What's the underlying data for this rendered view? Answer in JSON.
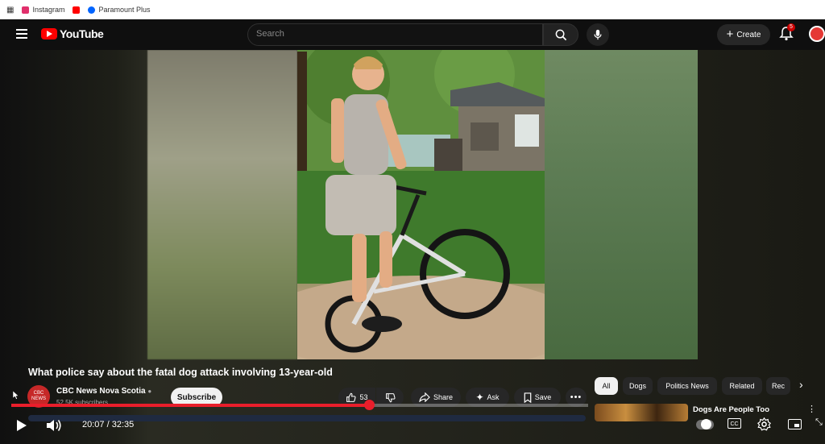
{
  "bookmarks": [
    {
      "label": "Instagram",
      "color": "#e1306c"
    },
    {
      "label": "",
      "color": "#ff0000"
    },
    {
      "label": "Paramount Plus",
      "color": "#0064ff"
    }
  ],
  "header": {
    "logo_text": "YouTube",
    "search_placeholder": "Search",
    "create_label": "Create",
    "notification_count": "5"
  },
  "video": {
    "title": "What police say about the fatal dog attack involving 13-year-old",
    "progress_fraction": 0.62
  },
  "channel": {
    "avatar_text": "CBC NEWS",
    "name": "CBC News Nova Scotia",
    "verified_icon": "verified-check-icon",
    "subscribers": "52.5K subscribers",
    "subscribe_label": "Subscribe"
  },
  "actions": {
    "likes": "53",
    "share_label": "Share",
    "ask_label": "Ask",
    "save_label": "Save"
  },
  "chips": [
    "All",
    "Dogs",
    "Politics News",
    "Related",
    "Rec"
  ],
  "recommendation": {
    "title": "Dogs Are People Too"
  },
  "player": {
    "current_time": "20:07",
    "duration": "32:35",
    "time_separator": "/"
  },
  "colors": {
    "brand_red": "#ff0000",
    "progress_red": "#e91e2b",
    "background": "#0f0f0f"
  }
}
